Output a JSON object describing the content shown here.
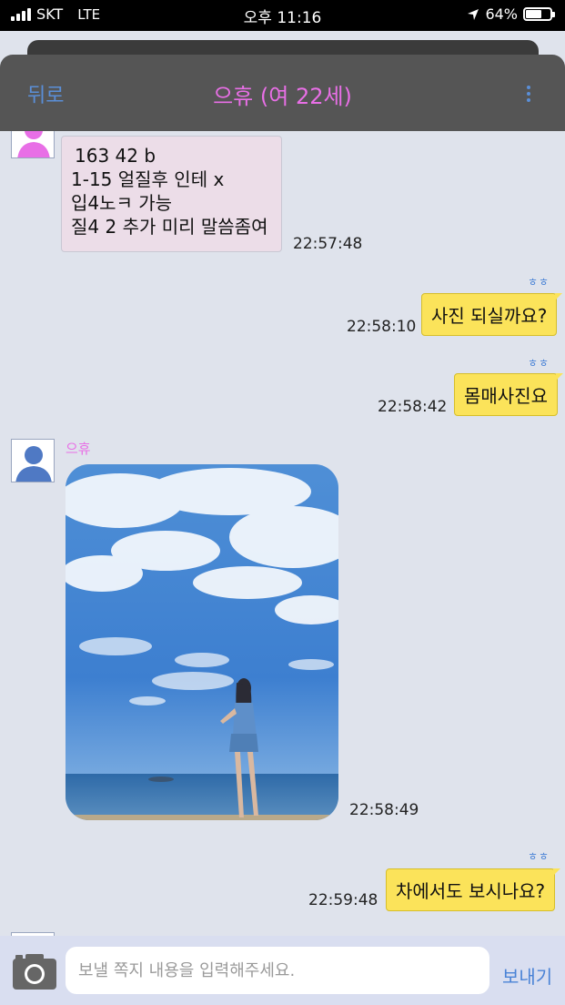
{
  "status_bar": {
    "carrier": "SKT",
    "network": "LTE",
    "time": "오후 11:16",
    "battery": "64%",
    "battery_level": 0.64
  },
  "header": {
    "back_label": "뒤로",
    "title": "으휴 (여 22세)"
  },
  "messages": [
    {
      "direction": "in",
      "lines": [
        "163 42 b",
        "1-15 얼질후 인테 x",
        "입4노ㅋ 가능",
        "질4 2 추가 미리 말씀좀여"
      ],
      "time": "22:57:48"
    },
    {
      "direction": "out",
      "sender": "ㅎㅎ",
      "text": "사진 되실까요?",
      "time": "22:58:10"
    },
    {
      "direction": "out",
      "sender": "ㅎㅎ",
      "text": "몸매사진요",
      "time": "22:58:42"
    },
    {
      "direction": "in",
      "sender": "으휴",
      "type": "image",
      "time": "22:58:49"
    },
    {
      "direction": "out",
      "sender": "ㅎㅎ",
      "text": "차에서도 보시나요?",
      "time": "22:59:48"
    }
  ],
  "input_bar": {
    "placeholder": "보낼 쪽지 내용을 입력해주세요.",
    "send_label": "보내기"
  },
  "icons": {
    "camera": "camera-icon",
    "menu": "more-vertical-icon",
    "avatar_female": "female-avatar-icon",
    "avatar_default": "person-avatar-icon",
    "location": "location-arrow-icon"
  },
  "colors": {
    "accent_pink": "#e86fe6",
    "accent_blue": "#4a83d6",
    "bubble_out": "#fbe35a",
    "bubble_in": "#ecdde8",
    "background": "#dfe3ec"
  }
}
